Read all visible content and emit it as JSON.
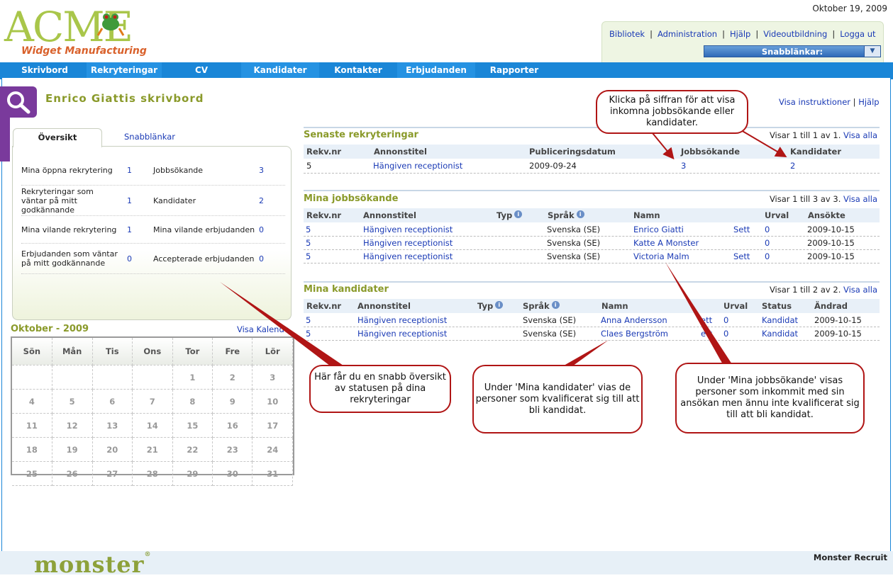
{
  "header": {
    "logo_text": "ACME",
    "logo_subtitle": "Widget Manufacturing",
    "date": "Oktober 19, 2009",
    "links": [
      "Bibliotek",
      "Administration",
      "Hjälp",
      "Videoutbildning",
      "Logga ut"
    ],
    "quicklinks_label": "Snabblänkar:"
  },
  "nav": [
    "Skrivbord",
    "Rekryteringar",
    "CV",
    "Kandidater",
    "Kontakter",
    "Erbjudanden",
    "Rapporter"
  ],
  "page": {
    "title": "Enrico Giattis skrivbord",
    "show_instructions": "Visa instruktioner",
    "help": "Hjälp"
  },
  "overview": {
    "tab_active": "Översikt",
    "tab_other": "Snabblänkar",
    "rows": [
      {
        "l_label": "Mina öppna rekrytering",
        "l_val": "1",
        "r_label": "Jobbsökande",
        "r_val": "3"
      },
      {
        "l_label": "Rekryteringar som väntar på mitt godkännande",
        "l_val": "1",
        "r_label": "Kandidater",
        "r_val": "2"
      },
      {
        "l_label": "Mina vilande rekrytering",
        "l_val": "1",
        "r_label": "Mina vilande erbjudanden",
        "r_val": "0"
      },
      {
        "l_label": "Erbjudanden som väntar på mitt godkännande",
        "l_val": "0",
        "r_label": "Accepterade erbjudanden",
        "r_val": "0"
      }
    ]
  },
  "calendar": {
    "title": "Oktober - 2009",
    "link": "Visa Kalender",
    "days": [
      "Sön",
      "Mån",
      "Tis",
      "Ons",
      "Tor",
      "Fre",
      "Lör"
    ],
    "weeks": [
      [
        "",
        "",
        "",
        "",
        "1",
        "2",
        "3"
      ],
      [
        "4",
        "5",
        "6",
        "7",
        "8",
        "9",
        "10"
      ],
      [
        "11",
        "12",
        "13",
        "14",
        "15",
        "16",
        "17"
      ],
      [
        "18",
        "19",
        "20",
        "21",
        "22",
        "23",
        "24"
      ],
      [
        "25",
        "26",
        "27",
        "28",
        "29",
        "30",
        "31"
      ]
    ]
  },
  "recent": {
    "title": "Senaste rekryteringar",
    "info": "Visar 1 till 1 av 1.",
    "show_all": "Visa alla",
    "headers": [
      "Rekv.nr",
      "Annonstitel",
      "Publiceringsdatum",
      "Jobbsökande",
      "Kandidater"
    ],
    "rows": [
      [
        "5",
        "Hängiven receptionist",
        "2009-09-24",
        "3",
        "2"
      ]
    ]
  },
  "seekers": {
    "title": "Mina jobbsökande",
    "info": "Visar 1 till 3 av 3.",
    "show_all": "Visa alla",
    "headers": [
      "Rekv.nr",
      "Annonstitel",
      "Typ",
      "Språk",
      "Namn",
      "Urval",
      "Ansökte"
    ],
    "rows": [
      [
        "5",
        "Hängiven receptionist",
        "",
        "Svenska (SE)",
        "Enrico Giatti",
        "Sett",
        "0",
        "2009-10-15"
      ],
      [
        "5",
        "Hängiven receptionist",
        "",
        "Svenska (SE)",
        "Katte A Monster",
        "",
        "0",
        "2009-10-15"
      ],
      [
        "5",
        "Hängiven receptionist",
        "",
        "Svenska (SE)",
        "Victoria Malm",
        "Sett",
        "0",
        "2009-10-15"
      ]
    ]
  },
  "candidates": {
    "title": "Mina kandidater",
    "info": "Visar 1 till 2 av 2.",
    "show_all": "Visa alla",
    "headers": [
      "Rekv.nr",
      "Annonstitel",
      "Typ",
      "Språk",
      "Namn",
      "Urval",
      "Status",
      "Ändrad"
    ],
    "rows": [
      [
        "5",
        "Hängiven receptionist",
        "",
        "Svenska (SE)",
        "Anna Andersson",
        "ett",
        "0",
        "Kandidat",
        "2009-10-15"
      ],
      [
        "5",
        "Hängiven receptionist",
        "",
        "Svenska (SE)",
        "Claes Bergström",
        "ett",
        "0",
        "Kandidat",
        "2009-10-15"
      ]
    ]
  },
  "callouts": {
    "top": "Klicka på siffran för att visa inkomna jobbsökande eller kandidater.",
    "overview": "Här får du en snabb översikt av statusen på dina rekryteringar",
    "candidates": "Under 'Mina kandidater' vias de personer som kvalificerat sig till att bli kandidat.",
    "seekers": "Under 'Mina jobbsökande' visas personer som inkommit med sin ansökan men  ännu inte kvalificerat sig till att bli kandidat."
  },
  "footer": {
    "brand": "monster",
    "product": "Monster Recruit"
  },
  "colors": {
    "nav_blue": "#1a86d7",
    "section_title": "#8a9a2a",
    "link": "#1a3ab5",
    "callout_border": "#b01515"
  }
}
